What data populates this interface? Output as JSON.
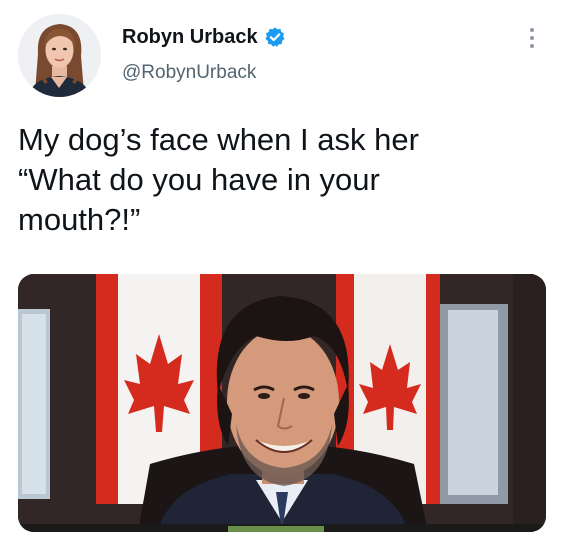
{
  "tweet": {
    "author_name": "Robyn Urback",
    "author_handle": "@RobynUrback",
    "text": "My dog’s face when I ask her\n“What do you have in your\nmouth?!”",
    "verified": true,
    "avatar_icon": "profile-photo",
    "verified_icon": "verified-badge-icon",
    "more_icon": "more-options-icon",
    "media_description_icon": "video-frame-photo"
  },
  "colors": {
    "verified_blue": "#1d9bf0",
    "handle_gray": "#536471",
    "text_dark": "#0f1419",
    "flag_red": "#d52b1e"
  }
}
